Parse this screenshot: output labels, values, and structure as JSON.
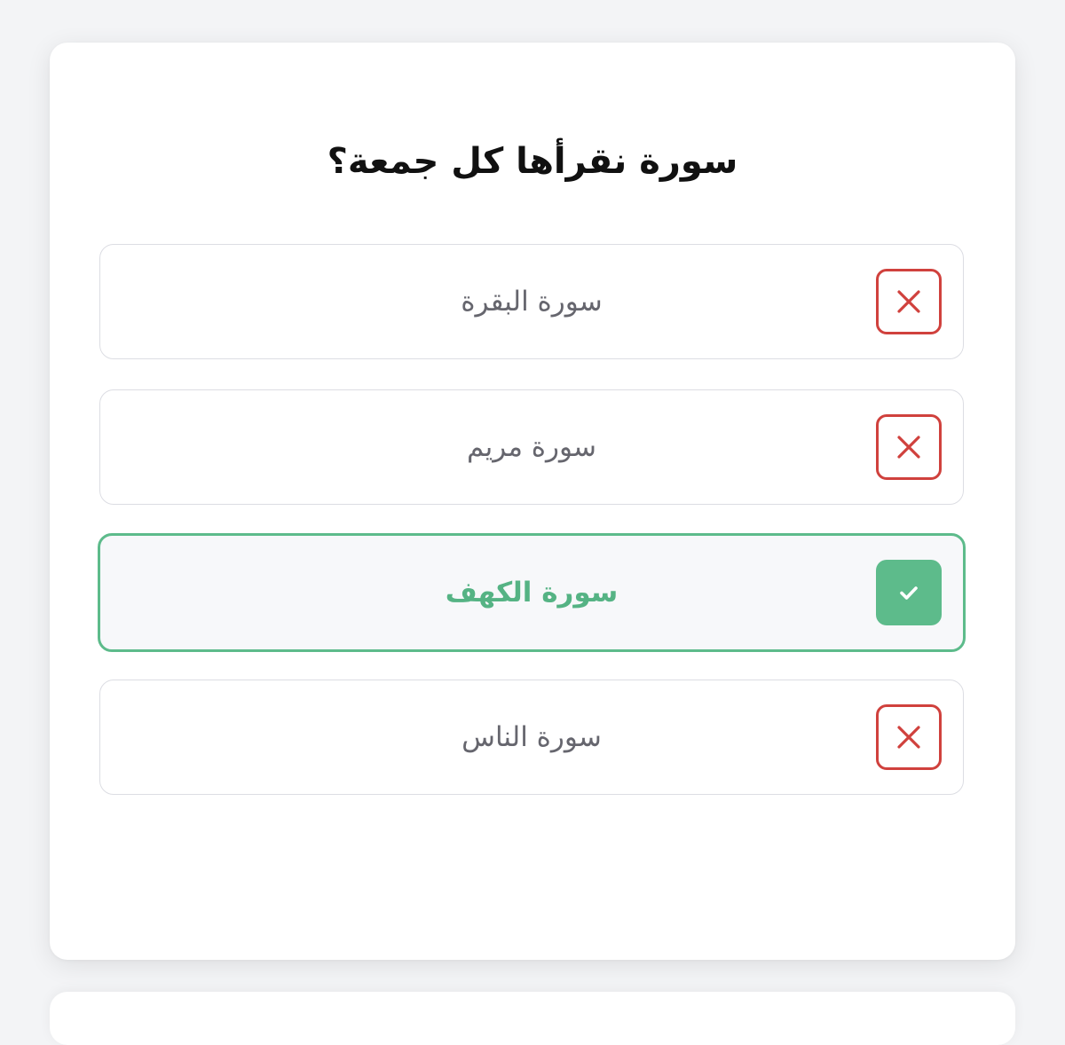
{
  "quiz": {
    "question": "سورة نقرأها كل جمعة؟",
    "options": [
      {
        "label": "سورة البقرة",
        "status": "wrong",
        "icon": "x-icon"
      },
      {
        "label": "سورة مريم",
        "status": "wrong",
        "icon": "x-icon"
      },
      {
        "label": "سورة الكهف",
        "status": "correct",
        "icon": "check-icon"
      },
      {
        "label": "سورة الناس",
        "status": "wrong",
        "icon": "x-icon"
      }
    ]
  },
  "colors": {
    "correct": "#5dbb8b",
    "correct_text": "#55b384",
    "wrong": "#d0413d",
    "option_text": "#66666e",
    "title": "#111111"
  }
}
